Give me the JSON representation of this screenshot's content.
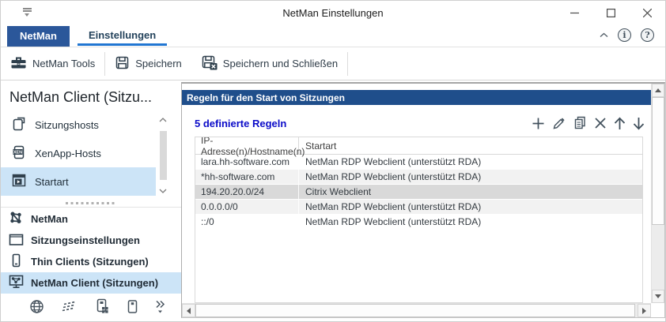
{
  "window": {
    "title": "NetMan Einstellungen"
  },
  "ribbon": {
    "tabs": [
      {
        "label": "NetMan",
        "active": false
      },
      {
        "label": "Einstellungen",
        "active": true
      }
    ],
    "buttons": [
      {
        "label": "NetMan Tools",
        "icon": "toolbox-icon"
      },
      {
        "label": "Speichern",
        "icon": "save-icon"
      },
      {
        "label": "Speichern und Schließen",
        "icon": "save-close-icon"
      }
    ],
    "icons": {
      "info": "i",
      "help": "?"
    }
  },
  "sidebar": {
    "title": "NetMan Client (Sitzu...",
    "items": [
      {
        "label": "Sitzungshosts",
        "icon": "session-hosts-icon",
        "selected": false
      },
      {
        "label": "XenApp-Hosts",
        "icon": "xenapp-icon",
        "icon_text": "XEN",
        "selected": false
      },
      {
        "label": "Startart",
        "icon": "start-type-icon",
        "selected": true
      }
    ],
    "groups": [
      {
        "label": "NetMan",
        "icon": "netman-nodes-icon",
        "selected": false
      },
      {
        "label": "Sitzungseinstellungen",
        "icon": "session-settings-icon",
        "selected": false
      },
      {
        "label": "Thin Clients (Sitzungen)",
        "icon": "thin-client-icon",
        "selected": false
      },
      {
        "label": "NetMan Client (Sitzungen)",
        "icon": "netman-client-icon",
        "selected": true
      }
    ],
    "bottom_icons": [
      "globe-icon",
      "scripts-icon",
      "device-apps-icon",
      "tablet-icon",
      "more-chevron-icon"
    ]
  },
  "content": {
    "header": "Regeln für den Start von Sitzungen",
    "rules_count_label": "5 definierte Regeln",
    "actions": [
      "add",
      "edit",
      "copy",
      "delete",
      "move-up",
      "move-down"
    ],
    "table": {
      "columns": [
        "IP-Adresse(n)/Hostname(n)",
        "Startart"
      ],
      "rows": [
        {
          "ip": "lara.hh-software.com",
          "start": "NetMan RDP Webclient (unterstützt RDA)",
          "selected": false
        },
        {
          "ip": "*hh-software.com",
          "start": "NetMan RDP Webclient (unterstützt RDA)",
          "selected": false
        },
        {
          "ip": "194.20.20.0/24",
          "start": "Citrix Webclient",
          "selected": true
        },
        {
          "ip": "0.0.0.0/0",
          "start": "NetMan RDP Webclient (unterstützt RDA)",
          "selected": false
        },
        {
          "ip": "::/0",
          "start": "NetMan RDP Webclient (unterstützt RDA)",
          "selected": false
        }
      ]
    }
  },
  "colors": {
    "tab_active_bg": "#2b579a",
    "tab_underline": "#2176d2",
    "panel_header_bg": "#1f4e8b",
    "rules_label": "#0a0ac8",
    "selection_bg": "#cce4f7",
    "selected_row_bg": "#d9d9d9",
    "alt_row_bg": "#f2f2f2",
    "icon_dark": "#2e3f4c"
  }
}
